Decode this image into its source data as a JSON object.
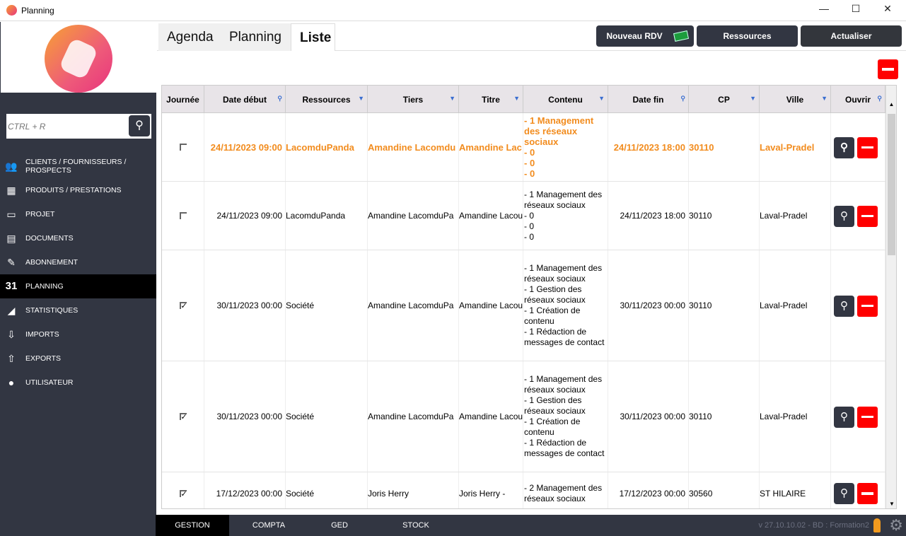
{
  "window": {
    "title": "Planning",
    "minimize": "—",
    "maximize": "☐",
    "close": "✕"
  },
  "sidebar": {
    "search_placeholder": "CTRL + R",
    "items": [
      {
        "label": "CLIENTS / FOURNISSEURS / PROSPECTS",
        "icon": "users-icon",
        "glyph": "👥"
      },
      {
        "label": "PRODUITS / PRESTATIONS",
        "icon": "grid-icon",
        "glyph": "▦"
      },
      {
        "label": "PROJET",
        "icon": "folder-icon",
        "glyph": "▭"
      },
      {
        "label": "DOCUMENTS",
        "icon": "document-icon",
        "glyph": "▤"
      },
      {
        "label": "ABONNEMENT",
        "icon": "contract-icon",
        "glyph": "✎"
      },
      {
        "label": "PLANNING",
        "icon": "calendar-icon",
        "glyph": "31",
        "active": true
      },
      {
        "label": "STATISTIQUES",
        "icon": "chart-icon",
        "glyph": "◢"
      },
      {
        "label": "IMPORTS",
        "icon": "arrow-down-circle-icon",
        "glyph": "⇩"
      },
      {
        "label": "EXPORTS",
        "icon": "arrow-up-circle-icon",
        "glyph": "⇧"
      },
      {
        "label": "UTILISATEUR",
        "icon": "user-icon",
        "glyph": "●"
      }
    ]
  },
  "tabs": [
    "Agenda",
    "Planning",
    "Liste"
  ],
  "active_tab": "Liste",
  "toolbar": {
    "new": "Nouveau RDV",
    "resources": "Ressources",
    "refresh": "Actualiser"
  },
  "columns": [
    "Journée",
    "Date début",
    "Ressources",
    "Tiers",
    "Titre",
    "Contenu",
    "Date fin",
    "CP",
    "Ville",
    "Ouvrir"
  ],
  "rows": [
    {
      "journee": false,
      "debut": "24/11/2023 09:00",
      "ressources": "LacomduPanda",
      "tiers": "Amandine Lacomdu",
      "titre": "Amandine Lac",
      "contenu": [
        "- 1 Management des réseaux sociaux",
        "- 0",
        "- 0",
        "- 0"
      ],
      "fin": "24/11/2023 18:00",
      "cp": "30110",
      "ville": "Laval-Pradel",
      "highlight": true
    },
    {
      "journee": false,
      "debut": "24/11/2023 09:00",
      "ressources": "LacomduPanda",
      "tiers": "Amandine LacomduPa",
      "titre": "Amandine Lacou",
      "contenu": [
        "- 1 Management des réseaux sociaux",
        "- 0",
        "- 0",
        "- 0"
      ],
      "fin": "24/11/2023 18:00",
      "cp": "30110",
      "ville": "Laval-Pradel"
    },
    {
      "journee": true,
      "debut": "30/11/2023 00:00",
      "ressources": "Société",
      "tiers": "Amandine LacomduPa",
      "titre": "Amandine Lacou",
      "contenu": [
        "- 1 Management des réseaux sociaux",
        "- 1 Gestion des réseaux sociaux",
        "- 1 Création de contenu",
        "- 1 Rédaction de messages de contact"
      ],
      "fin": "30/11/2023 00:00",
      "cp": "30110",
      "ville": "Laval-Pradel"
    },
    {
      "journee": true,
      "debut": "30/11/2023 00:00",
      "ressources": "Société",
      "tiers": "Amandine LacomduPa",
      "titre": "Amandine Lacou",
      "contenu": [
        "- 1 Management des réseaux sociaux",
        "- 1 Gestion des réseaux sociaux",
        "- 1 Création de contenu",
        "- 1 Rédaction de messages de contact"
      ],
      "fin": "30/11/2023 00:00",
      "cp": "30110",
      "ville": "Laval-Pradel"
    },
    {
      "journee": true,
      "debut": "17/12/2023 00:00",
      "ressources": "Société",
      "tiers": "Joris Herry",
      "titre": "Joris Herry -",
      "contenu": [
        "- 2 Management des réseaux sociaux"
      ],
      "fin": "17/12/2023 00:00",
      "cp": "30560",
      "ville": "ST HILAIRE"
    }
  ],
  "bottom": {
    "tabs": [
      "GESTION",
      "COMPTA",
      "GED",
      "STOCK"
    ],
    "active": "GESTION",
    "version": "v 27.10.10.02 - BD : Formation2"
  },
  "colors": {
    "sidebar": "#323642",
    "highlight": "#f28c1e",
    "delete": "#ff0000"
  }
}
